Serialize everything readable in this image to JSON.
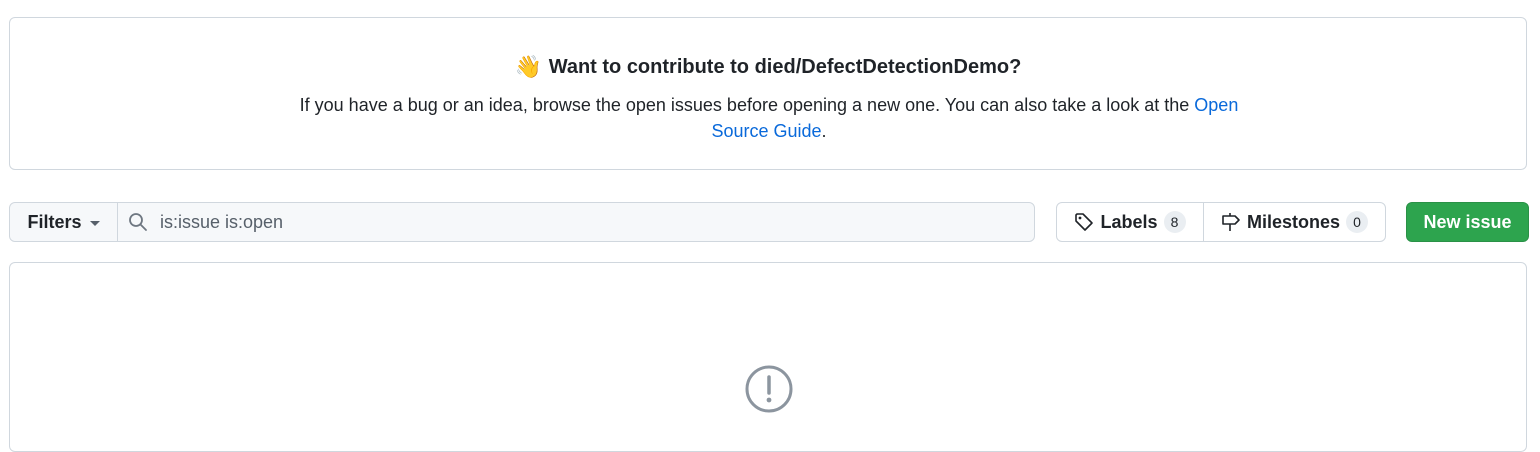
{
  "contribute": {
    "title": "Want to contribute to died/DefectDetectionDemo?",
    "text_before_link": "If you have a bug or an idea, browse the open issues before opening a new one. You can also take a look at the ",
    "link_label": "Open Source Guide",
    "text_after_link": ".",
    "icon": "waving-hand-icon"
  },
  "filter_bar": {
    "filters_label": "Filters",
    "search_value": "is:issue is:open",
    "search_icon": "search-icon"
  },
  "nav": {
    "labels_label": "Labels",
    "labels_count": "8",
    "milestones_label": "Milestones",
    "milestones_count": "0"
  },
  "new_issue_label": "New issue",
  "colors": {
    "primary_button": "#2da44e",
    "link": "#0969da",
    "border": "#d0d7de"
  },
  "empty_state": {
    "icon": "issue-opened-icon"
  }
}
